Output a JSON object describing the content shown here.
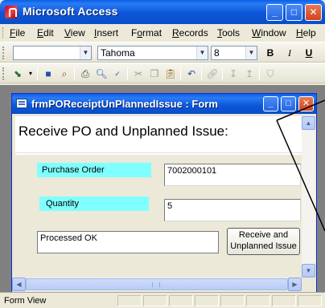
{
  "app": {
    "title": "Microsoft Access"
  },
  "menu": {
    "items": [
      {
        "label": "File",
        "key": "F",
        "rest": "ile"
      },
      {
        "label": "Edit",
        "key": "E",
        "rest": "dit"
      },
      {
        "label": "View",
        "key": "V",
        "rest": "iew"
      },
      {
        "label": "Insert",
        "key": "I",
        "rest": "nsert"
      },
      {
        "label": "Format",
        "pre": "F",
        "key": "o",
        "rest": "rmat"
      },
      {
        "label": "Records",
        "key": "R",
        "rest": "ecords"
      },
      {
        "label": "Tools",
        "key": "T",
        "rest": "ools"
      },
      {
        "label": "Window",
        "key": "W",
        "rest": "indow"
      },
      {
        "label": "Help",
        "key": "H",
        "rest": "elp"
      }
    ]
  },
  "format_toolbar": {
    "object_combo": "",
    "font_combo": "Tahoma",
    "size_combo": "8",
    "bold": "B",
    "italic": "I",
    "underline": "U"
  },
  "form_window": {
    "title": "frmPOReceiptUnPlannedIssue : Form",
    "header": "Receive PO and Unplanned Issue:",
    "fields": {
      "purchase_order": {
        "label": "Purchase Order",
        "value": "7002000101"
      },
      "quantity": {
        "label": "Quantity",
        "value": "5"
      }
    },
    "status_message": "Processed OK",
    "action_button": {
      "line1": "Receive and",
      "line2": "Unplanned Issue"
    }
  },
  "statusbar": {
    "text": "Form View"
  },
  "colors": {
    "label_highlight": "#80ffff",
    "title_bar": "#0b56d8"
  }
}
